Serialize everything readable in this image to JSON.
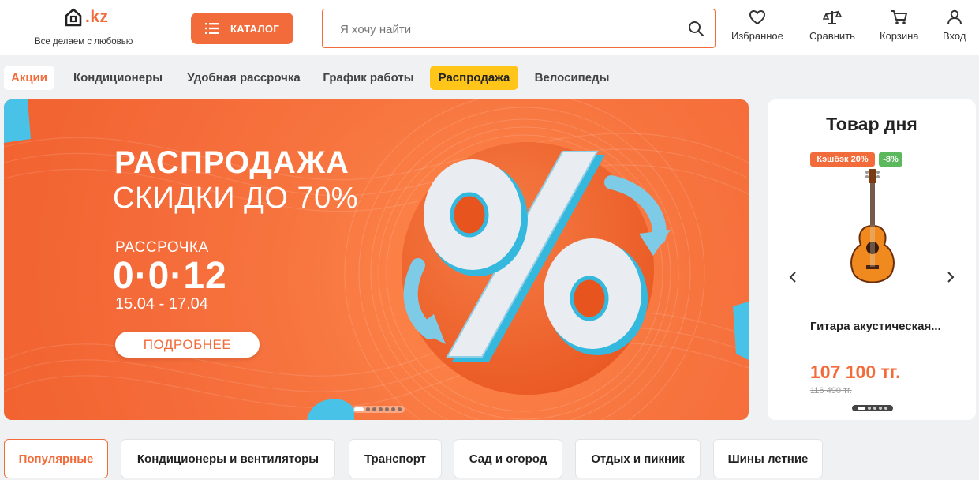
{
  "brand": {
    "logo_suffix": ".kz",
    "tagline": "Все делаем с любовью",
    "accent": "#f26b3a"
  },
  "header": {
    "catalog_label": "КАТАЛОГ",
    "search_placeholder": "Я хочу найти",
    "actions": [
      {
        "label": "Избранное",
        "icon": "heart-icon"
      },
      {
        "label": "Сравнить",
        "icon": "scales-icon"
      },
      {
        "label": "Корзина",
        "icon": "cart-icon"
      },
      {
        "label": "Вход",
        "icon": "user-icon"
      }
    ]
  },
  "categories": [
    "Акции",
    "Кондиционеры",
    "Удобная рассрочка",
    "График работы",
    "Распродажа",
    "Велосипеды"
  ],
  "banner": {
    "title": "РАСПРОДАЖА",
    "subtitle": "СКИДКИ ДО 70%",
    "installment_label": "РАССРОЧКА",
    "installment_terms": "0·0·12",
    "dates": "15.04 - 17.04",
    "more_button": "ПОДРОБНЕЕ",
    "slide_count": 7,
    "active_slide": 1
  },
  "product_of_day": {
    "title": "Товар дня",
    "badge_cashback": "Кэшбэк 20%",
    "badge_discount": "-8%",
    "name": "Гитара акустическая...",
    "price": "107 100 тг.",
    "old_price": "116 490 тг.",
    "image": "acoustic-guitar"
  },
  "bottom_tabs": [
    "Популярные",
    "Кондиционеры и вентиляторы",
    "Транспорт",
    "Сад и огород",
    "Отдых и пикник",
    "Шины летние"
  ]
}
